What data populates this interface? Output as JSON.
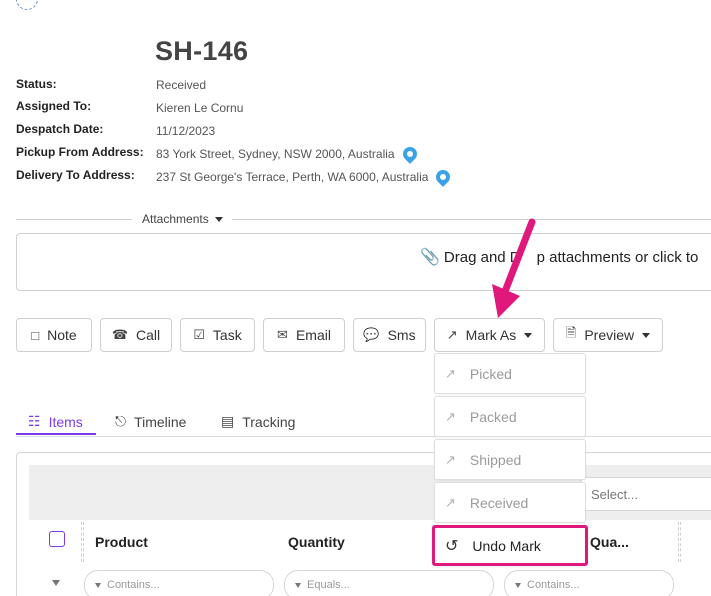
{
  "shipment": {
    "title": "SH-146",
    "fields": [
      {
        "label": "Status:",
        "value": "Received"
      },
      {
        "label": "Assigned To:",
        "value": "Kieren Le Cornu"
      },
      {
        "label": "Despatch Date:",
        "value": "11/12/2023"
      },
      {
        "label": "Pickup From Address:",
        "value": "83 York Street, Sydney, NSW 2000, Australia"
      },
      {
        "label": "Delivery To Address:",
        "value": "237 St George's Terrace, Perth, WA 6000, Australia"
      }
    ]
  },
  "attachments": {
    "label": "Attachments",
    "dropzone_text_1": "Drag and D",
    "dropzone_text_2": "p attachments or click to"
  },
  "actions": {
    "note": "Note",
    "call": "Call",
    "task": "Task",
    "email": "Email",
    "sms": "Sms",
    "mark_as": "Mark As",
    "preview": "Preview"
  },
  "mark_menu": {
    "items": [
      "Picked",
      "Packed",
      "Shipped",
      "Received",
      "Undo Mark"
    ]
  },
  "tabs": {
    "items": "Items",
    "timeline": "Timeline",
    "tracking": "Tracking"
  },
  "grid": {
    "select_placeholder": "Select...",
    "columns": [
      "Product",
      "Quantity",
      "Qua..."
    ],
    "filters": [
      "Contains...",
      "Equals...",
      "Contains..."
    ]
  },
  "colors": {
    "accent": "#7c3aed",
    "highlight": "#e0187c",
    "map_pin": "#3aa3e8"
  }
}
